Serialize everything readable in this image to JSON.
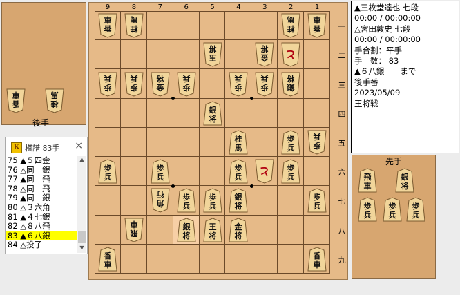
{
  "info_lines": [
    "▲三枚堂達也 七段",
    "00:00 / 00:00:00",
    "△宮田敦史 七段",
    "00:00 / 00:00:00",
    "手合割：平手",
    "手　数： 83",
    "▲６八銀　　まで",
    "後手番",
    "2023/05/09",
    "王将戦"
  ],
  "stands": {
    "gote_label": "後手",
    "sente_label": "先手"
  },
  "file_labels": [
    "9",
    "8",
    "7",
    "6",
    "5",
    "4",
    "3",
    "2",
    "1"
  ],
  "rank_labels": [
    "一",
    "二",
    "三",
    "四",
    "五",
    "六",
    "七",
    "八",
    "九"
  ],
  "kifu": {
    "icon": "K",
    "title": "棋譜 83手",
    "close": "×",
    "moves": [
      "75 ▲５四金",
      "76 △同　銀",
      "77 ▲同　飛",
      "78 △同　飛",
      "79 ▲同　銀",
      "80 △３六角",
      "81 ▲４七銀",
      "82 △８八飛",
      "83 ▲６八銀",
      "84 △投了"
    ],
    "selected_index": 8
  },
  "board": {
    "last_move": {
      "file": 6,
      "rank": 8
    },
    "pieces": [
      {
        "file": 9,
        "rank": 1,
        "top": "香",
        "bottom": "車",
        "side": "gote"
      },
      {
        "file": 8,
        "rank": 1,
        "top": "桂",
        "bottom": "馬",
        "side": "gote"
      },
      {
        "file": 2,
        "rank": 1,
        "top": "桂",
        "bottom": "馬",
        "side": "gote"
      },
      {
        "file": 1,
        "rank": 1,
        "top": "香",
        "bottom": "車",
        "side": "gote"
      },
      {
        "file": 5,
        "rank": 2,
        "top": "玉",
        "bottom": "将",
        "side": "gote"
      },
      {
        "file": 3,
        "rank": 2,
        "top": "金",
        "bottom": "将",
        "side": "gote"
      },
      {
        "file": 2,
        "rank": 2,
        "top": "と",
        "bottom": "",
        "side": "gote"
      },
      {
        "file": 9,
        "rank": 3,
        "top": "歩",
        "bottom": "兵",
        "side": "gote"
      },
      {
        "file": 8,
        "rank": 3,
        "top": "歩",
        "bottom": "兵",
        "side": "gote"
      },
      {
        "file": 7,
        "rank": 3,
        "top": "金",
        "bottom": "将",
        "side": "gote"
      },
      {
        "file": 6,
        "rank": 3,
        "top": "歩",
        "bottom": "兵",
        "side": "gote"
      },
      {
        "file": 4,
        "rank": 3,
        "top": "歩",
        "bottom": "兵",
        "side": "gote"
      },
      {
        "file": 3,
        "rank": 3,
        "top": "歩",
        "bottom": "兵",
        "side": "gote"
      },
      {
        "file": 2,
        "rank": 3,
        "top": "銀",
        "bottom": "将",
        "side": "gote"
      },
      {
        "file": 5,
        "rank": 4,
        "top": "銀",
        "bottom": "将",
        "side": "sente"
      },
      {
        "file": 4,
        "rank": 5,
        "top": "桂",
        "bottom": "馬",
        "side": "sente"
      },
      {
        "file": 2,
        "rank": 5,
        "top": "歩",
        "bottom": "兵",
        "side": "sente"
      },
      {
        "file": 1,
        "rank": 5,
        "top": "歩",
        "bottom": "兵",
        "side": "gote"
      },
      {
        "file": 9,
        "rank": 6,
        "top": "歩",
        "bottom": "兵",
        "side": "sente"
      },
      {
        "file": 7,
        "rank": 6,
        "top": "歩",
        "bottom": "兵",
        "side": "sente"
      },
      {
        "file": 4,
        "rank": 6,
        "top": "歩",
        "bottom": "兵",
        "side": "sente"
      },
      {
        "file": 3,
        "rank": 6,
        "top": "と",
        "bottom": "",
        "side": "gote"
      },
      {
        "file": 2,
        "rank": 6,
        "top": "歩",
        "bottom": "兵",
        "side": "sente"
      },
      {
        "file": 7,
        "rank": 7,
        "top": "角",
        "bottom": "行",
        "side": "gote"
      },
      {
        "file": 6,
        "rank": 7,
        "top": "歩",
        "bottom": "兵",
        "side": "sente"
      },
      {
        "file": 5,
        "rank": 7,
        "top": "歩",
        "bottom": "兵",
        "side": "sente"
      },
      {
        "file": 4,
        "rank": 7,
        "top": "銀",
        "bottom": "将",
        "side": "sente"
      },
      {
        "file": 1,
        "rank": 7,
        "top": "歩",
        "bottom": "兵",
        "side": "sente"
      },
      {
        "file": 8,
        "rank": 8,
        "top": "飛",
        "bottom": "車",
        "side": "gote"
      },
      {
        "file": 6,
        "rank": 8,
        "top": "銀",
        "bottom": "将",
        "side": "sente"
      },
      {
        "file": 5,
        "rank": 8,
        "top": "王",
        "bottom": "将",
        "side": "sente"
      },
      {
        "file": 4,
        "rank": 8,
        "top": "金",
        "bottom": "将",
        "side": "sente"
      },
      {
        "file": 9,
        "rank": 9,
        "top": "香",
        "bottom": "車",
        "side": "sente"
      },
      {
        "file": 1,
        "rank": 9,
        "top": "香",
        "bottom": "車",
        "side": "sente"
      }
    ]
  },
  "gote_hand": [
    {
      "top": "香",
      "bottom": "車"
    },
    {
      "top": "桂",
      "bottom": "馬"
    }
  ],
  "sente_hand": [
    {
      "top": "飛",
      "bottom": "車"
    },
    {
      "top": "銀",
      "bottom": "将"
    },
    {
      "top": "歩",
      "bottom": "兵"
    },
    {
      "top": "歩",
      "bottom": "兵"
    },
    {
      "top": "歩",
      "bottom": "兵"
    }
  ]
}
